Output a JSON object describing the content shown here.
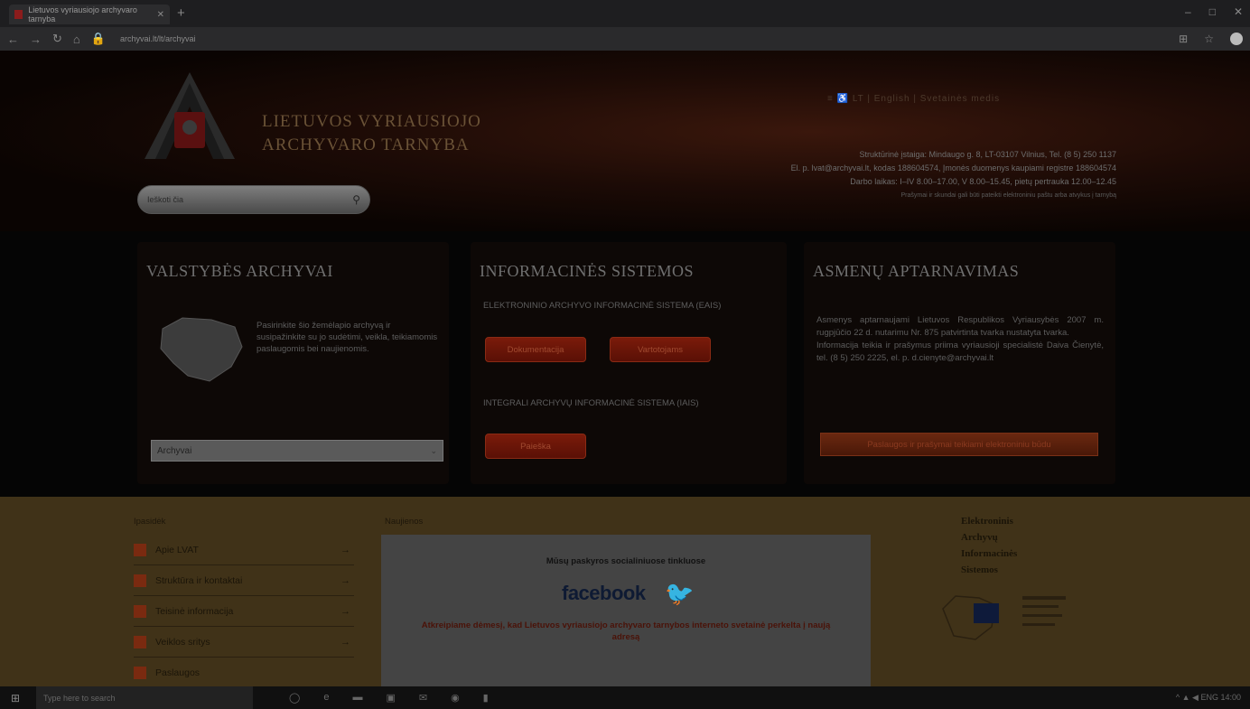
{
  "browser": {
    "tab_title": "Lietuvos vyriausiojo archyvaro tarnyba",
    "new_tab": "+",
    "url": "archyvai.lt/lt/archyvai",
    "window_controls": [
      "–",
      "□",
      "✕"
    ]
  },
  "header": {
    "logo_line1": "LIETUVOS VYRIAUSIOJO",
    "logo_line2": "ARCHYVARO TARNYBA",
    "search_placeholder": "Ieškoti čia",
    "languages": "≡  ♿  LT | English | Svetainės medis",
    "contact_lines": [
      "Struktūrinė įstaiga: Mindaugo g. 8, LT-03107 Vilnius, Tel. (8 5) 250 1137",
      "El. p. lvat@archyvai.lt, kodas 188604574, Įmonės duomenys kaupiami registre 188604574",
      "Darbo laikas: I–IV 8.00–17.00, V 8.00–15.45, pietų pertrauka 12.00–12.45",
      "Prašymai ir skundai gali būti pateikti elektroniniu paštu arba atvykus į tarnybą"
    ]
  },
  "panels": {
    "state_archives": {
      "title": "VALSTYBĖS ARCHYVAI",
      "text": "Pasirinkite šio žemėlapio archyvą ir susipažinkite su jo sudėtimi, veikla, teikiamomis paslaugomis bei naujienomis.",
      "select_value": "Archyvai"
    },
    "info_systems": {
      "title": "INFORMACINĖS SISTEMOS",
      "eais_label": "ELEKTRONINIO ARCHYVO INFORMACINĖ SISTEMA (EAIS)",
      "eais_btn1": "Dokumentacija",
      "eais_btn2": "Vartotojams",
      "ivs_label": "INTEGRALI ARCHYVŲ INFORMACINĖ SISTEMA (IAIS)",
      "ivs_btn": "Paieška"
    },
    "services": {
      "title": "ASMENŲ APTARNAVIMAS",
      "text1": "Asmenys aptarnaujami Lietuvos Respublikos Vyriausybės 2007 m. rugpjūčio 22 d. nutarimu Nr. 875 patvirtinta tvarka nustatyta tvarka.",
      "text2": "Informacija teikia ir prašymus priima vyriausioji specialistė Daiva Čienytė, tel. (8 5) 250 2225, el. p. d.cienyte@archyvai.lt",
      "button": "Paslaugos ir prašymai teikiami elektroniniu būdu"
    }
  },
  "footer": {
    "menu_title": "Ipasidėk",
    "menu_items": [
      "Apie LVAT",
      "Struktūra ir kontaktai",
      "Teisinė informacija",
      "Veiklos sritys",
      "Paslaugos"
    ],
    "news_title": "Naujienos",
    "news_head": "Mūsų paskyros socialiniuose tinkluose",
    "facebook": "facebook",
    "news_red": "Atkreipiame dėmesį, kad Lietuvos vyriausiojo archyvaro tarnybos interneto svetainė perkelta į naują adresą",
    "right_lines": [
      "Elektroninis",
      "Archyvų",
      "Informacinės",
      "Sistemos"
    ]
  },
  "taskbar": {
    "search_placeholder": "Type here to search",
    "tray": "^  ▲  ◀  ENG  14:00"
  }
}
